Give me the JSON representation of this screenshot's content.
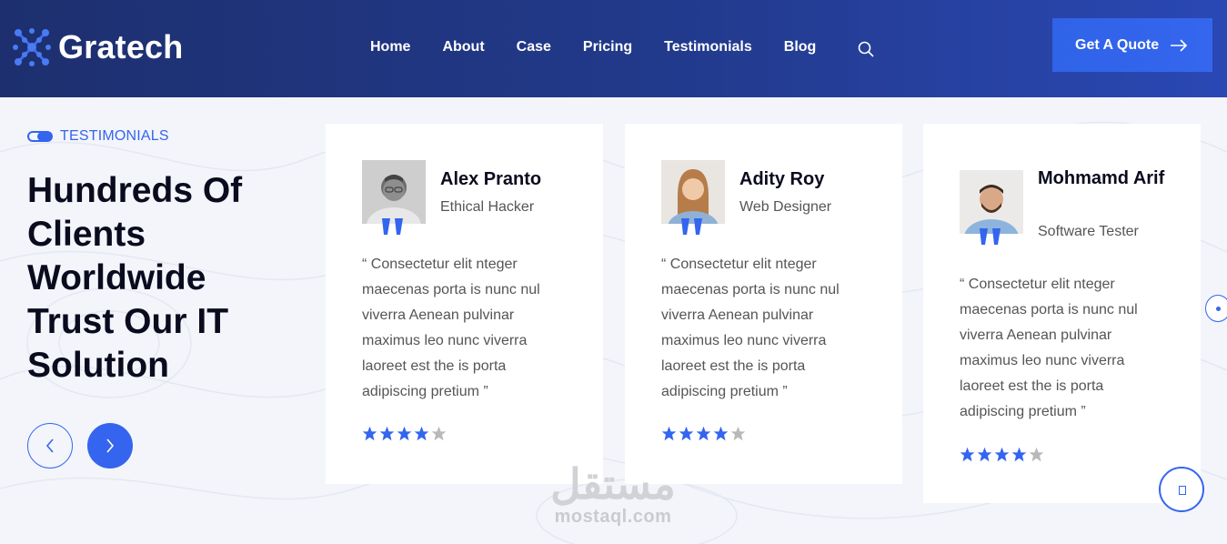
{
  "brand": {
    "name": "Gratech",
    "logo_icon": "molecule-x-icon",
    "accent": "#3465ef"
  },
  "nav": {
    "items": [
      {
        "label": "Home"
      },
      {
        "label": "About"
      },
      {
        "label": "Case"
      },
      {
        "label": "Pricing"
      },
      {
        "label": "Testimonials"
      },
      {
        "label": "Blog"
      }
    ],
    "search_icon": "search-icon",
    "cta_label": "Get A Quote",
    "cta_icon": "arrow-right-icon"
  },
  "section": {
    "eyebrow": "TESTIMONIALS",
    "heading_lines": [
      "Hundreds Of",
      "Clients",
      "Worldwide",
      "Trust Our IT",
      "Solution"
    ]
  },
  "testimonials": [
    {
      "name": "Alex Pranto",
      "role": "Ethical Hacker",
      "text": "“ Consectetur elit nteger maecenas porta is nunc nul viverra Aenean pulvinar maximus leo nunc viverra laoreet est the is porta adipiscing pretium ”",
      "rating": 4,
      "max_rating": 5
    },
    {
      "name": "Adity Roy",
      "role": "Web Designer",
      "text": "“ Consectetur elit nteger maecenas porta is nunc nul viverra Aenean pulvinar maximus leo nunc viverra laoreet est the is porta adipiscing pretium ”",
      "rating": 4,
      "max_rating": 5
    },
    {
      "name": "Mohmamd Arif",
      "role": "Software Tester",
      "text": "“ Consectetur elit nteger maecenas porta is nunc nul viverra Aenean pulvinar maximus leo nunc viverra laoreet est the is porta adipiscing pretium ”",
      "rating": 4,
      "max_rating": 5
    }
  ],
  "watermark": {
    "arabic": "مستقل",
    "latin": "mostaql.com"
  }
}
